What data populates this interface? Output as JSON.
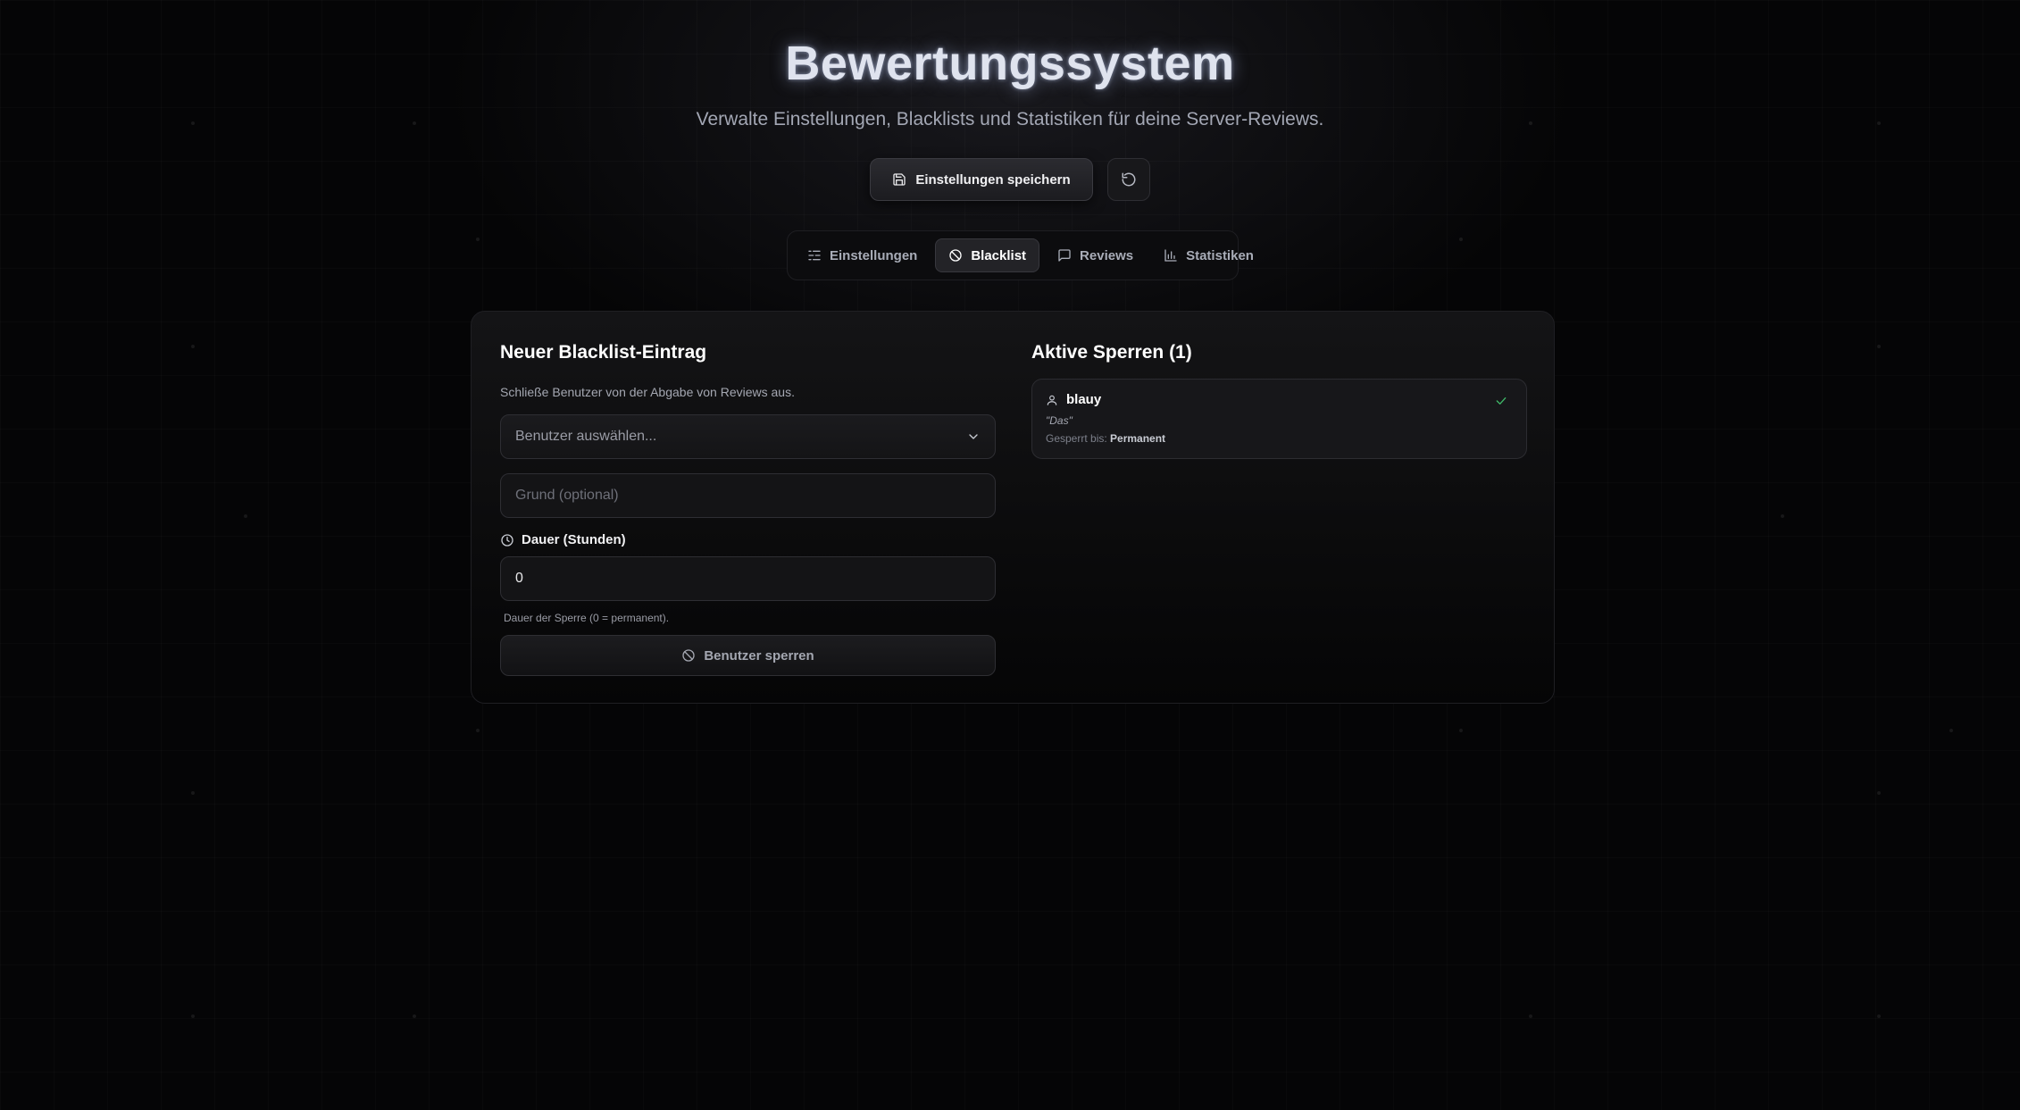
{
  "header": {
    "title": "Bewertungssystem",
    "subtitle": "Verwalte Einstellungen, Blacklists und Statistiken für deine Server-Reviews."
  },
  "actions": {
    "save_label": "Einstellungen speichern",
    "save_icon": "save-icon",
    "reset_icon": "rotate-ccw-icon"
  },
  "tabs": [
    {
      "label": "Einstellungen",
      "icon": "sliders-icon",
      "active": false
    },
    {
      "label": "Blacklist",
      "icon": "ban-icon",
      "active": true
    },
    {
      "label": "Reviews",
      "icon": "message-square-icon",
      "active": false
    },
    {
      "label": "Statistiken",
      "icon": "bar-chart-icon",
      "active": false
    }
  ],
  "form": {
    "heading": "Neuer Blacklist-Eintrag",
    "description": "Schließe Benutzer von der Abgabe von Reviews aus.",
    "user_select_placeholder": "Benutzer auswählen...",
    "reason_placeholder": "Grund (optional)",
    "duration_label": "Dauer (Stunden)",
    "duration_value": "0",
    "duration_hint": "Dauer der Sperre (0 = permanent).",
    "submit_label": "Benutzer sperren"
  },
  "active_bans": {
    "heading": "Aktive Sperren (1)",
    "entries": [
      {
        "user": "blauy",
        "reason": "\"Das\"",
        "until_label": "Gesperrt bis:",
        "until_value": "Permanent"
      }
    ]
  },
  "colors": {
    "background": "#050506",
    "panel": "#141416",
    "accent_check": "#3fb868"
  }
}
